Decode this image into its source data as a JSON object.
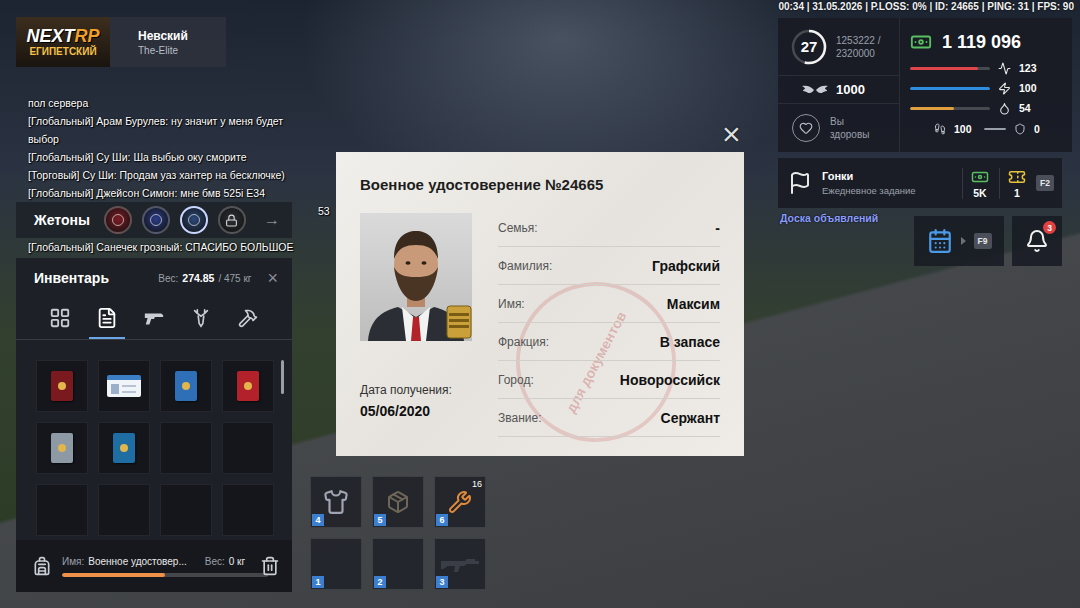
{
  "status_bar": "00:34 | 31.05.2026 | P.LOSS: 0% | ID: 24665 | PING: 31 | FPS: 90",
  "logo": {
    "brand": "NEXT",
    "accent": "RP",
    "subtitle": "ЕГИПЕТСКИЙ"
  },
  "server": {
    "name": "Невский",
    "family": "The-Elite"
  },
  "chat": [
    {
      "text": "пол сервера",
      "kind": "line"
    },
    {
      "text": "[Глобальный] Арам Бурулев: ну значит у меня будет",
      "kind": "line"
    },
    {
      "text": "выбор",
      "kind": "line"
    },
    {
      "text": "[Глобальный] Су Ши: Ша выбью оку сморите",
      "kind": "line"
    },
    {
      "text": "[Торговый] Су Ши: Продам уаз хантер на бесключке)",
      "kind": "line"
    },
    {
      "text": "[Глобальный] Джейсон Симон: мне бмв 525i E34",
      "kind": "line"
    },
    {
      "text": "53",
      "kind": "cut"
    },
    {
      "text": "[Глобальный] Санечек грозный: СПАСИБО БОЛЬШОЕ",
      "kind": "line"
    }
  ],
  "tokens": {
    "title": "Жетоны",
    "arrow": "→",
    "items": [
      {
        "color": "#7e1c24",
        "selected": false,
        "locked": false
      },
      {
        "color": "#2a3c86",
        "selected": false,
        "locked": false
      },
      {
        "color": "#2c4a7a",
        "selected": true,
        "locked": false
      },
      {
        "color": "#2e3036",
        "selected": false,
        "locked": true
      }
    ]
  },
  "inventory": {
    "title": "Инвентарь",
    "weight_label": "Вес:",
    "weight": "274.85",
    "weight_max": "/ 475 кг",
    "close": "×",
    "tabs": [
      {
        "kind": "grid",
        "selected": false
      },
      {
        "kind": "documents",
        "selected": true
      },
      {
        "kind": "weapons",
        "selected": false
      },
      {
        "kind": "hunting",
        "selected": false
      },
      {
        "kind": "crafting",
        "selected": false
      }
    ],
    "slots": [
      {
        "kind": "booklet",
        "color": "#7a1a1e"
      },
      {
        "kind": "card",
        "color": "#3d7fc4"
      },
      {
        "kind": "booklet",
        "color": "#2f6fb8"
      },
      {
        "kind": "booklet",
        "color": "#b3222a"
      },
      {
        "kind": "booklet",
        "color": "#8e99a6"
      },
      {
        "kind": "booklet",
        "color": "#1f6ea3"
      },
      {
        "kind": "empty",
        "color": "#000000"
      },
      {
        "kind": "empty",
        "color": "#000000"
      },
      {
        "kind": "empty",
        "color": "#000000"
      },
      {
        "kind": "empty",
        "color": "#000000"
      },
      {
        "kind": "empty",
        "color": "#000000"
      },
      {
        "kind": "empty",
        "color": "#000000"
      }
    ],
    "selected_item": {
      "name_label": "Имя:",
      "name": "Военное удостовер...",
      "weight_label": "Вес:",
      "weight": "0 кг",
      "level": 0.5
    }
  },
  "hotbar": [
    {
      "key": "4",
      "kind": "armor"
    },
    {
      "key": "5",
      "kind": "box"
    },
    {
      "key": "6",
      "kind": "tools",
      "count": "16"
    },
    {
      "key": "1",
      "kind": "empty"
    },
    {
      "key": "2",
      "kind": "empty"
    },
    {
      "key": "3",
      "kind": "rifle"
    }
  ],
  "card": {
    "title": "Военное удостоверение №24665",
    "close": "×",
    "fields": [
      {
        "label": "Семья:",
        "value": "-"
      },
      {
        "label": "Фамилия:",
        "value": "Графский"
      },
      {
        "label": "Имя:",
        "value": "Максим"
      },
      {
        "label": "Фракция:",
        "value": "В запасе"
      },
      {
        "label": "Город:",
        "value": "Новороссийск"
      },
      {
        "label": "Звание:",
        "value": "Сержант"
      }
    ],
    "date_label": "Дата получения:",
    "date": "05/06/2020",
    "stamp": "для документов"
  },
  "hud": {
    "level": "27",
    "xp": "1253222 /",
    "xp_max": "2320000",
    "xp_level": 0.54,
    "money": "1 119 096",
    "donate": "1000",
    "health_status": "Вы здоровы",
    "stats": [
      {
        "kind": "health",
        "value": "123",
        "level": 0.85,
        "color": "#e0454b"
      },
      {
        "kind": "energy",
        "value": "100",
        "level": 1,
        "color": "#2f8de0"
      },
      {
        "kind": "water",
        "value": "54",
        "level": 0.55,
        "color": "#e0a040"
      }
    ],
    "small_stats": [
      {
        "kind": "stamina",
        "value": "100",
        "level": 1
      },
      {
        "kind": "armor",
        "value": "0",
        "level": 0
      }
    ]
  },
  "task": {
    "title": "Гонки",
    "subtitle": "Ежедневное задание",
    "reward_money": "5K",
    "reward_tickets": "1",
    "key": "F2"
  },
  "board": "Доска объявлений",
  "calendar_key": "F9",
  "notifications": "3"
}
